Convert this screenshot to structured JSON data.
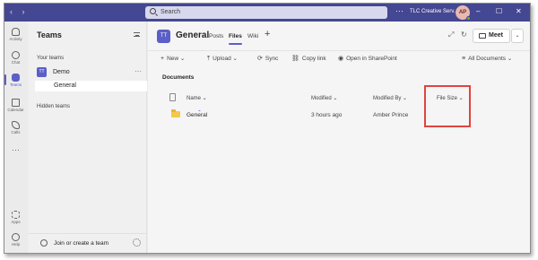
{
  "titlebar": {
    "search_placeholder": "Search",
    "more": "···",
    "org": "TLC Creative Serv...",
    "avatar_initials": "AP",
    "window_controls": [
      "–",
      "☐",
      "✕"
    ]
  },
  "rail": {
    "items": [
      {
        "label": "Activity",
        "icon": "bell-icon"
      },
      {
        "label": "Chat",
        "icon": "chat-icon"
      },
      {
        "label": "Teams",
        "icon": "teams-icon",
        "active": true
      },
      {
        "label": "Calendar",
        "icon": "calendar-icon"
      },
      {
        "label": "Calls",
        "icon": "phone-icon"
      },
      {
        "label": "···",
        "icon": "more-icon"
      },
      {
        "label": "Apps",
        "icon": "apps-icon"
      },
      {
        "label": "Help",
        "icon": "help-icon"
      }
    ]
  },
  "teams_pane": {
    "title": "Teams",
    "your_teams": "Your teams",
    "team_name": "Demo",
    "team_initials": "TT",
    "team_more": "···",
    "channel": "General",
    "hidden_teams": "Hidden teams",
    "join_label": "Join or create a team"
  },
  "channel": {
    "initials": "TT",
    "name": "General",
    "tabs": [
      "Posts",
      "Files",
      "Wiki"
    ],
    "active_tab": "Files",
    "add_tab": "+",
    "meet_label": "Meet",
    "expand_icon": "⤢",
    "refresh_icon": "↻"
  },
  "toolbar": {
    "new": "New",
    "upload": "Upload",
    "sync": "Sync",
    "copy_link": "Copy link",
    "open_sharepoint": "Open in SharePoint",
    "view": "All Documents"
  },
  "documents": {
    "title": "Documents",
    "columns": {
      "name": "Name",
      "modified": "Modified",
      "modified_by": "Modified By",
      "file_size": "File Size"
    },
    "rows": [
      {
        "name": "General",
        "modified": "3 hours ago",
        "modified_by": "Amber Prince",
        "file_size": ""
      }
    ]
  },
  "colors": {
    "titlebar": "#444791",
    "accent": "#5b5fc7",
    "highlight": "#e0443e"
  }
}
